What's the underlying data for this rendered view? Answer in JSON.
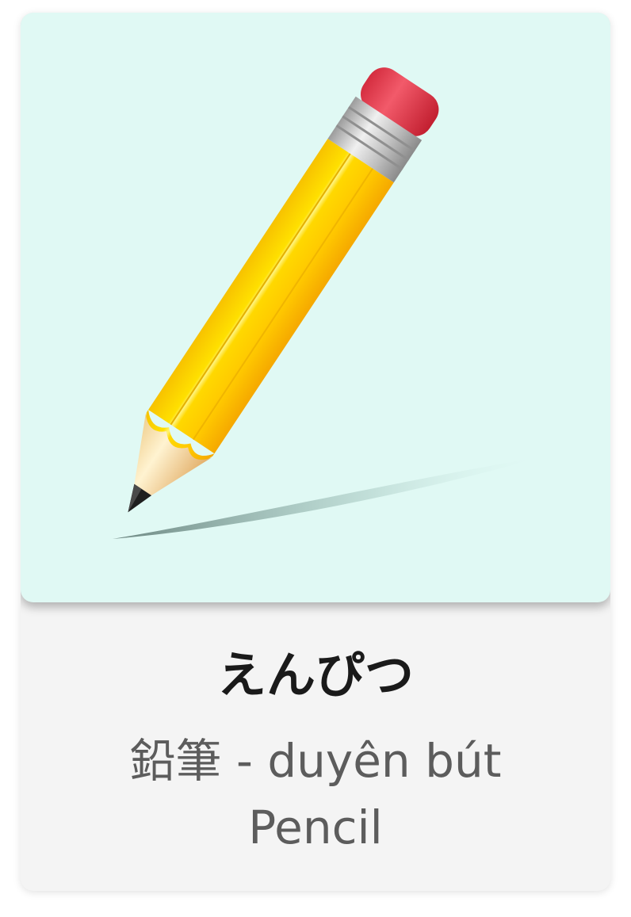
{
  "card": {
    "hiragana": "えんぴつ",
    "kanji_reading": "鉛筆 - duyên bút",
    "english": "Pencil"
  },
  "illustration": {
    "subject": "pencil-icon",
    "background_color": "#e0f9f4"
  },
  "colors": {
    "pencil_body": "#ffd400",
    "eraser": "#e8364a",
    "ferrule": "#c9c9c9",
    "wood": "#f3d9a0",
    "lead": "#222222",
    "card_background": "#f4f4f4"
  }
}
